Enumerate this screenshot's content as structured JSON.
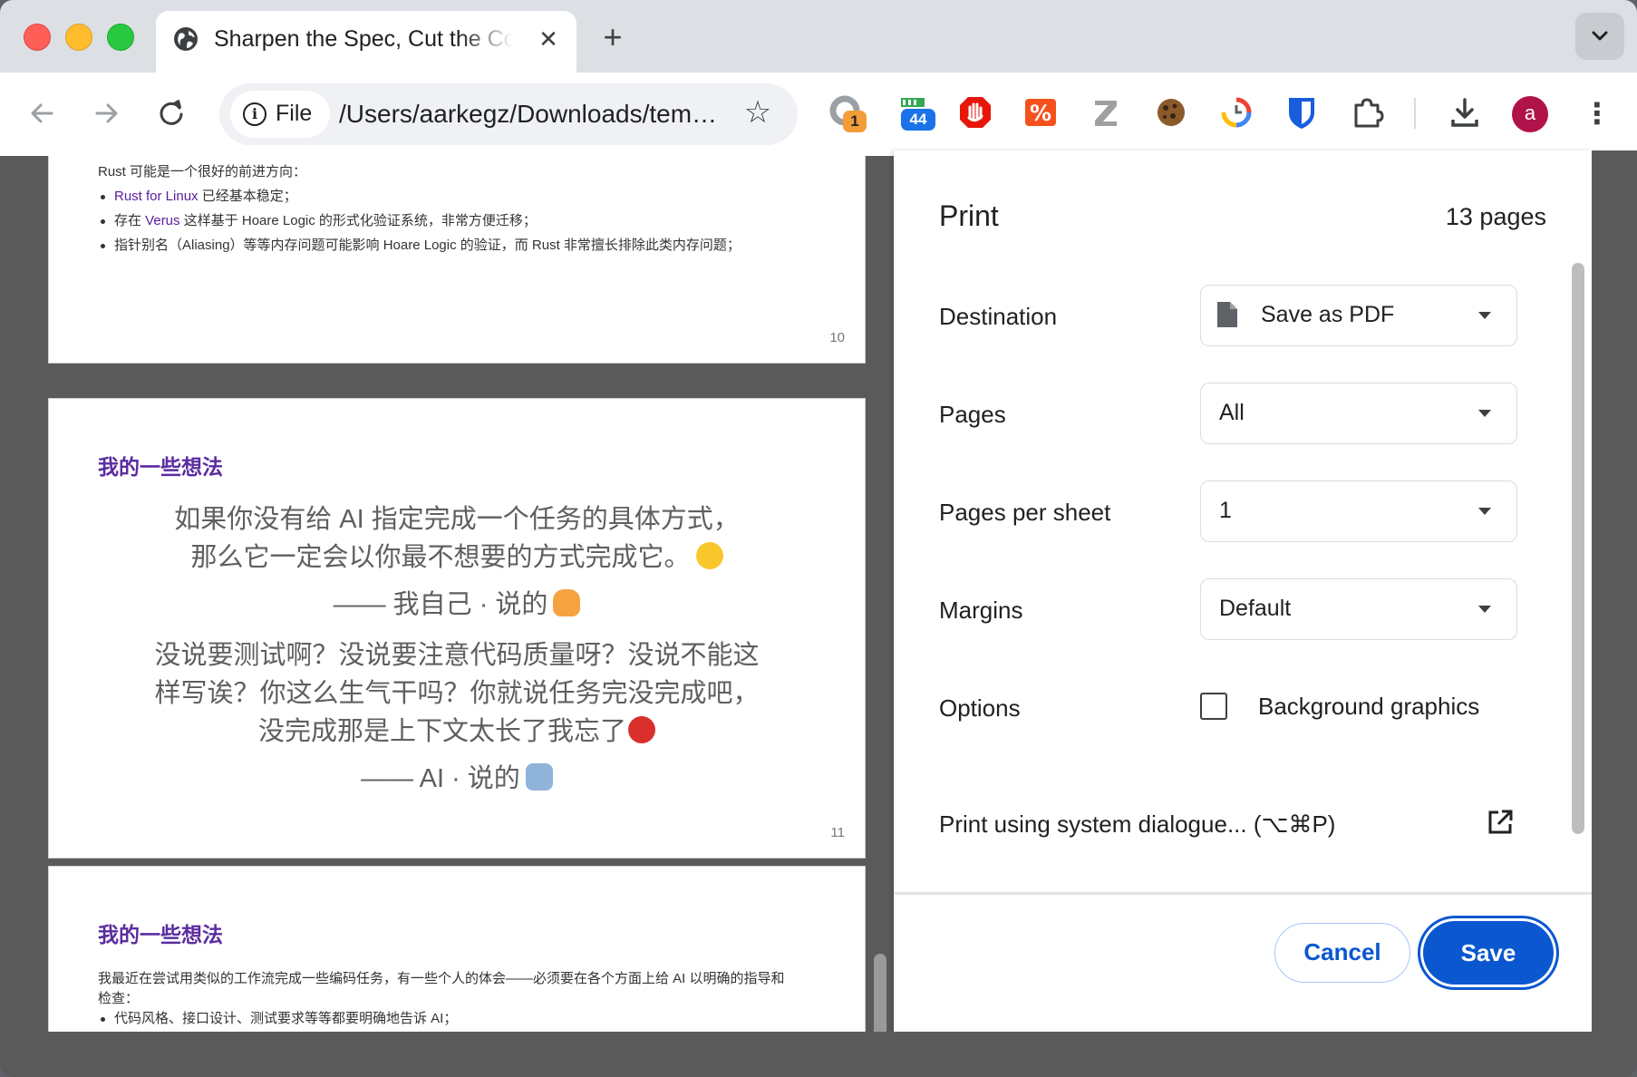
{
  "browser": {
    "tab_title": "Sharpen the Spec, Cut the Code",
    "url_chip": "File",
    "url": "/Users/aarkegz/Downloads/temp/sharpen-the-spec.pdf",
    "extension_badges": {
      "ext1": "1",
      "ext2": "44"
    },
    "avatar_letter": "a"
  },
  "preview": {
    "page10": {
      "intro": "Rust 可能是一个很好的前进方向：",
      "bullets": [
        {
          "link": "Rust for Linux",
          "text": " 已经基本稳定；"
        },
        {
          "pre": "存在 ",
          "link": "Verus",
          "text": " 这样基于 Hoare Logic 的形式化验证系统，非常方便迁移；"
        },
        {
          "text": "指针别名（Aliasing）等等内存问题可能影响 Hoare Logic 的验证，而 Rust 非常擅长排除此类内存问题；"
        }
      ],
      "number": "10"
    },
    "page11": {
      "heading": "我的一些想法",
      "quote1_line1": "如果你没有给 AI 指定完成一个任务的具体方式，",
      "quote1_line2": "那么它一定会以你最不想要的方式完成它。",
      "attrib1": "—— 我自己 · 说的",
      "quote2_line1": "没说要测试啊？没说要注意代码质量呀？没说不能这",
      "quote2_line2": "样写诶？你这么生气干吗？你就说任务完没完成吧，",
      "quote2_line3": "没完成那是上下文太长了我忘了",
      "attrib2": "—— AI · 说的",
      "number": "11"
    },
    "page12": {
      "heading": "我的一些想法",
      "para_line1": "我最近在尝试用类似的工作流完成一些编码任务，有一些个人的体会——必须要在各个方面上给 AI 以明确的指导和",
      "para_line2": "检查：",
      "bullet1": "代码风格、接口设计、测试要求等等都要明确地告诉 AI；"
    }
  },
  "print_dialog": {
    "title": "Print",
    "page_count": "13 pages",
    "destination_label": "Destination",
    "destination_value": "Save as PDF",
    "pages_label": "Pages",
    "pages_value": "All",
    "pps_label": "Pages per sheet",
    "pps_value": "1",
    "margins_label": "Margins",
    "margins_value": "Default",
    "options_label": "Options",
    "background_graphics": "Background graphics",
    "background_graphics_checked": false,
    "system_dialog": "Print using system dialogue... (⌥⌘P)",
    "cancel": "Cancel",
    "save": "Save",
    "accent": "#0b57d0"
  }
}
